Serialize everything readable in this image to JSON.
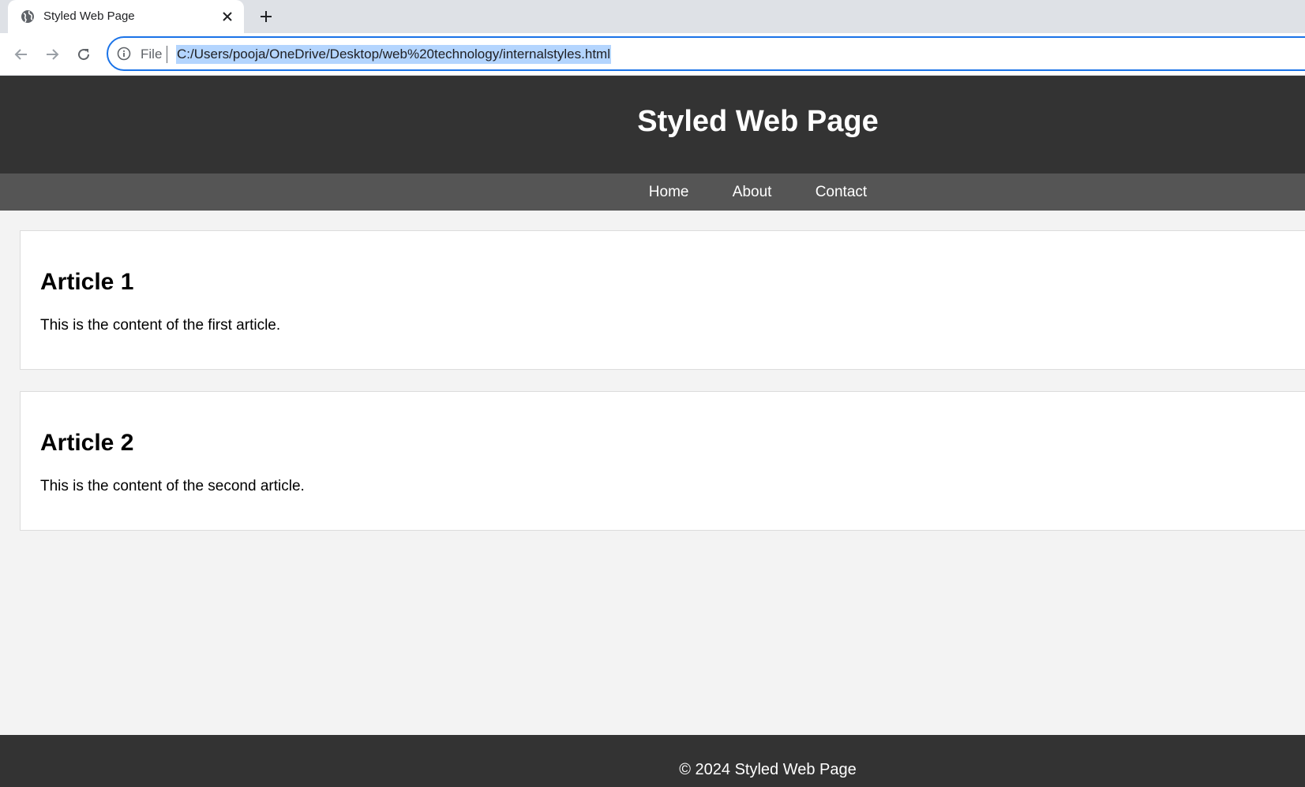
{
  "browser": {
    "tab": {
      "title": "Styled Web Page",
      "favicon": "globe-icon"
    },
    "toolbar": {
      "back_icon": "arrow-left-icon",
      "forward_icon": "arrow-right-icon",
      "reload_icon": "reload-icon",
      "site_info_icon": "info-icon",
      "scheme_label": "File",
      "url": "C:/Users/pooja/OneDrive/Desktop/web%20technology/internalstyles.html"
    }
  },
  "page": {
    "header": {
      "title": "Styled Web Page"
    },
    "nav": {
      "items": [
        {
          "label": "Home"
        },
        {
          "label": "About"
        },
        {
          "label": "Contact"
        }
      ]
    },
    "articles": [
      {
        "heading": "Article 1",
        "body": "This is the content of the first article."
      },
      {
        "heading": "Article 2",
        "body": "This is the content of the second article."
      }
    ],
    "footer": {
      "text": "© 2024 Styled Web Page"
    }
  },
  "colors": {
    "header_bg": "#333333",
    "nav_bg": "#555555",
    "page_bg": "#f3f3f3",
    "omnibox_focus": "#1a73e8",
    "url_selection": "#b4d5fe"
  }
}
